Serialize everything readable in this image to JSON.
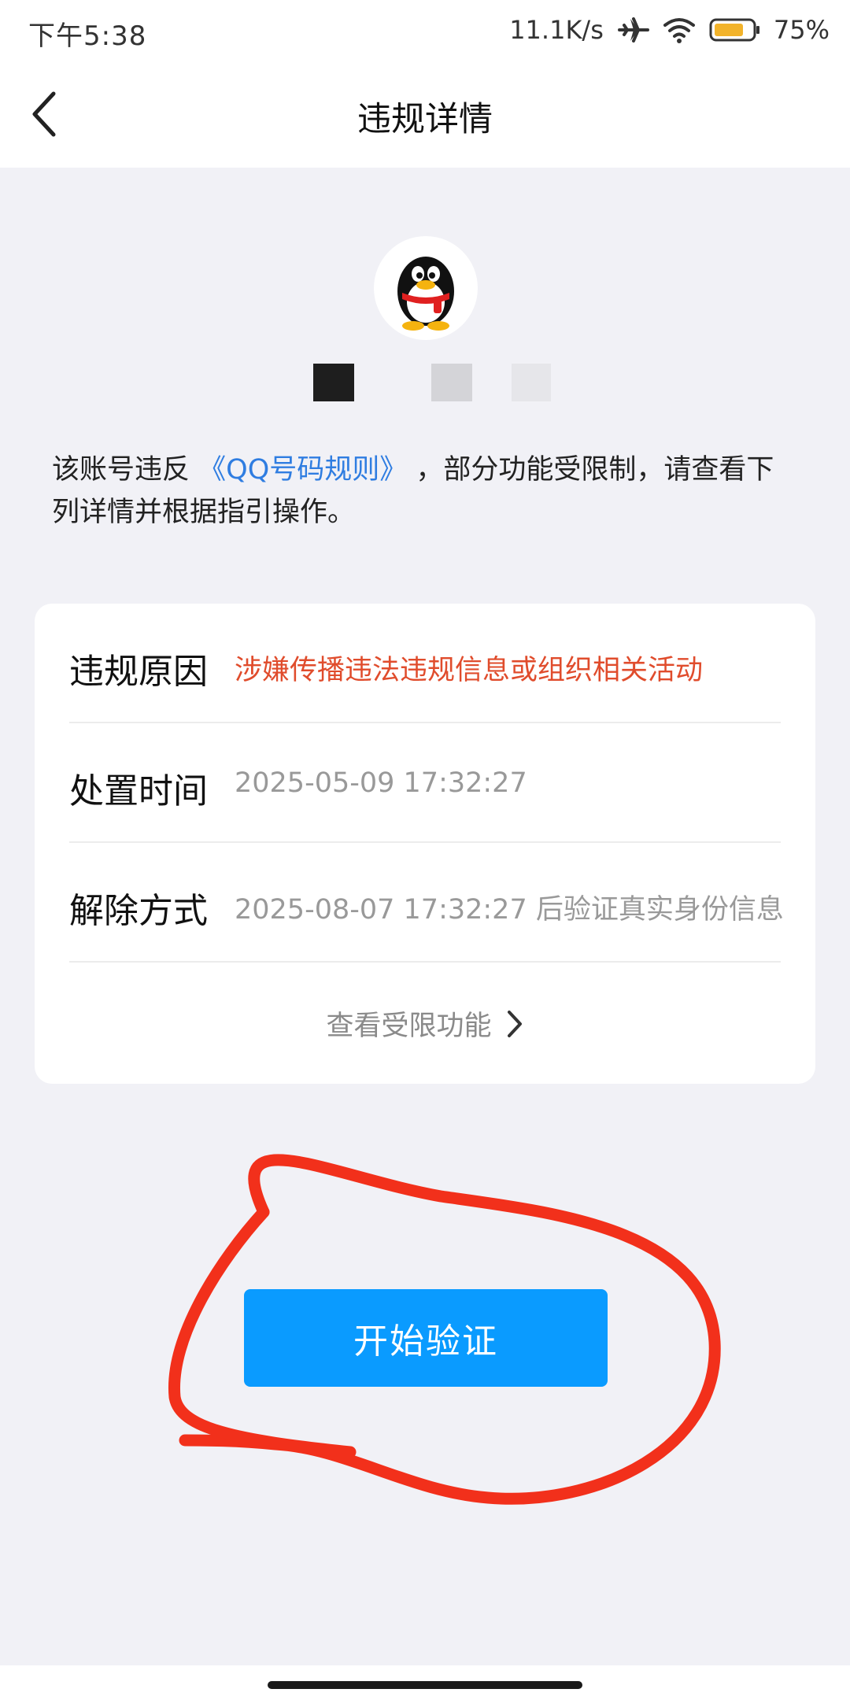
{
  "status_bar": {
    "time": "下午5:38",
    "net_speed": "11.1K/s",
    "battery_percent": "75%",
    "icons": [
      "airplane-icon",
      "wifi-icon",
      "battery-icon"
    ]
  },
  "nav": {
    "title": "违规详情",
    "back_icon": "chevron-left-icon"
  },
  "profile": {
    "avatar": "qq-penguin-logo"
  },
  "notice": {
    "prefix": "该账号违反",
    "rule_link": "《QQ号码规则》",
    "suffix": "，部分功能受限制，请查看下列详情并根据指引操作。"
  },
  "details": {
    "rows": [
      {
        "label": "违规原因",
        "value": "涉嫌传播违法违规信息或组织相关活动"
      },
      {
        "label": "处置时间",
        "value": "2025-05-09 17:32:27"
      },
      {
        "label": "解除方式",
        "value": "2025-08-07 17:32:27 后验证真实身份信息"
      }
    ],
    "more_link": "查看受限功能"
  },
  "action": {
    "start_button": "开始验证"
  },
  "colors": {
    "accent_blue": "#0a9bff",
    "link_blue": "#2f7de1",
    "reason_red": "#e04c2c",
    "annotation_red": "#f2301b",
    "background": "#f1f1f6"
  }
}
